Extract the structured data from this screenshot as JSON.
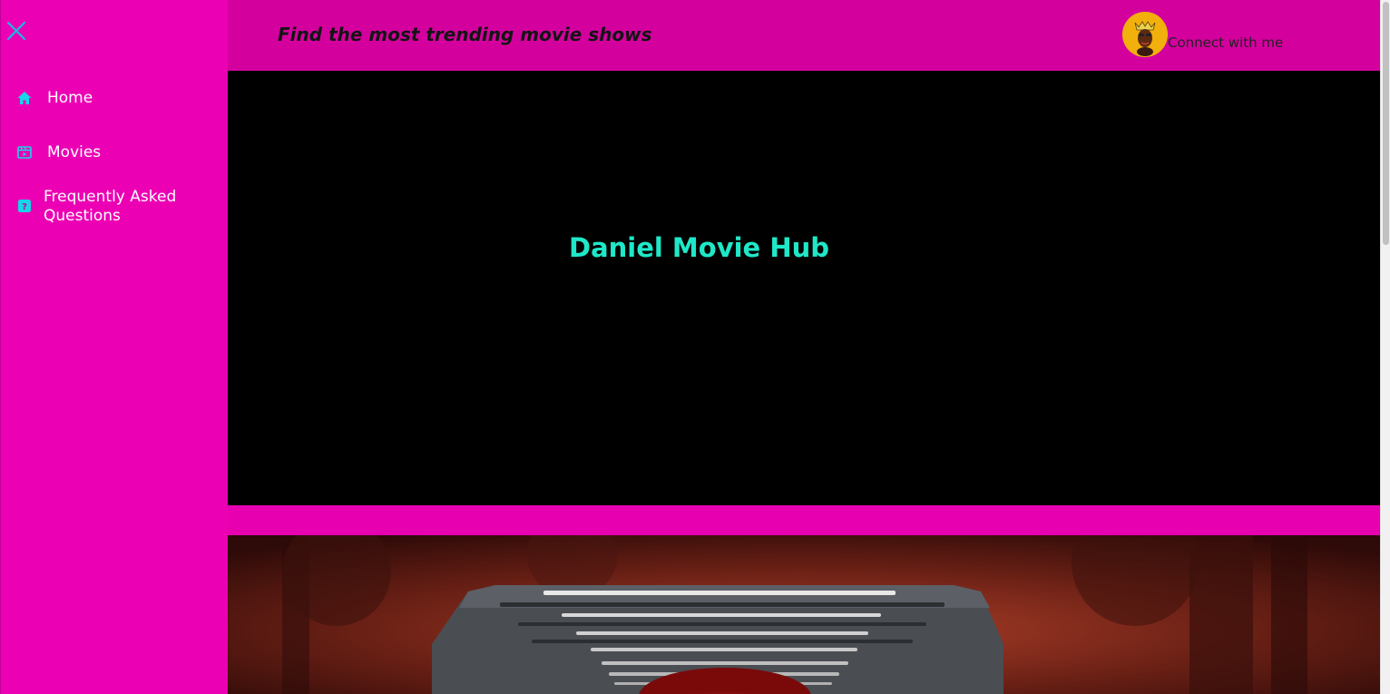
{
  "sidebar": {
    "close_icon": "close-x-icon",
    "items": [
      {
        "label": "Home",
        "icon": "home-icon"
      },
      {
        "label": "Movies",
        "icon": "film-icon"
      },
      {
        "label": "Frequently Asked Questions",
        "icon": "question-icon"
      }
    ]
  },
  "header": {
    "tagline": "Find the most trending movie shows",
    "connect_label": "Connect with me"
  },
  "hero": {
    "title": "Daniel Movie Hub"
  },
  "colors": {
    "sidebar_bg": "#ec00b4",
    "header_bg": "#d4009e",
    "accent_cyan": "#1ee8c8",
    "hero_bg": "#000000"
  }
}
